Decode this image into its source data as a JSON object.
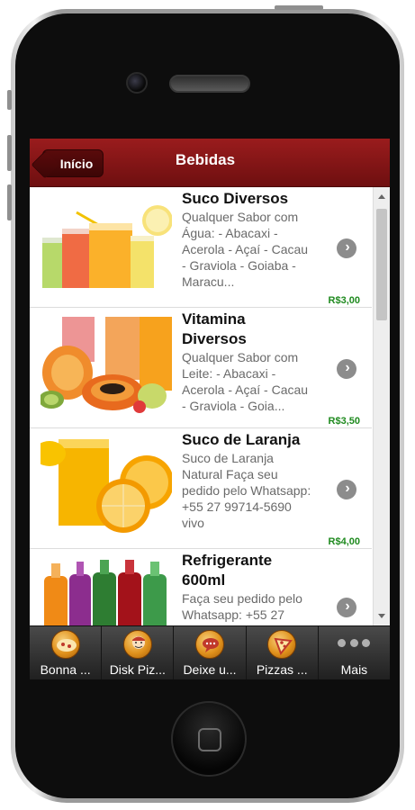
{
  "header": {
    "back_label": "Início",
    "title": "Bebidas"
  },
  "items": [
    {
      "title": "Suco Diversos",
      "description": [
        "Qualquer Sabor com",
        "Água: - Abacaxi -",
        "Acerola - Açaí - Cacau",
        "- Graviola - Goiaba -",
        "Maracu..."
      ],
      "price": "R$3,00"
    },
    {
      "title": [
        "Vitamina",
        "Diversos"
      ],
      "description": [
        "Qualquer Sabor com",
        "Leite: - Abacaxi -",
        "Acerola - Açaí - Cacau",
        "- Graviola - Goia..."
      ],
      "price": "R$3,50"
    },
    {
      "title": "Suco de Laranja",
      "description": [
        "Suco de Laranja",
        "Natural Faça seu",
        "pedido pelo Whatsapp:",
        "+55 27 99714-5690",
        "vivo"
      ],
      "price": "R$4,00"
    },
    {
      "title": [
        "Refrigerante",
        "600ml"
      ],
      "description": [
        "Faça seu pedido pelo",
        "Whatsapp: +55 27"
      ],
      "price": ""
    }
  ],
  "tabs": [
    {
      "label": "Bonna ...",
      "icon": "pizza-logo-icon"
    },
    {
      "label": "Disk Piz...",
      "icon": "delivery-man-icon"
    },
    {
      "label": "Deixe u...",
      "icon": "speech-bubble-icon"
    },
    {
      "label": "Pizzas ...",
      "icon": "pizza-slice-icon"
    },
    {
      "label": "Mais",
      "icon": "more-dots-icon"
    }
  ]
}
